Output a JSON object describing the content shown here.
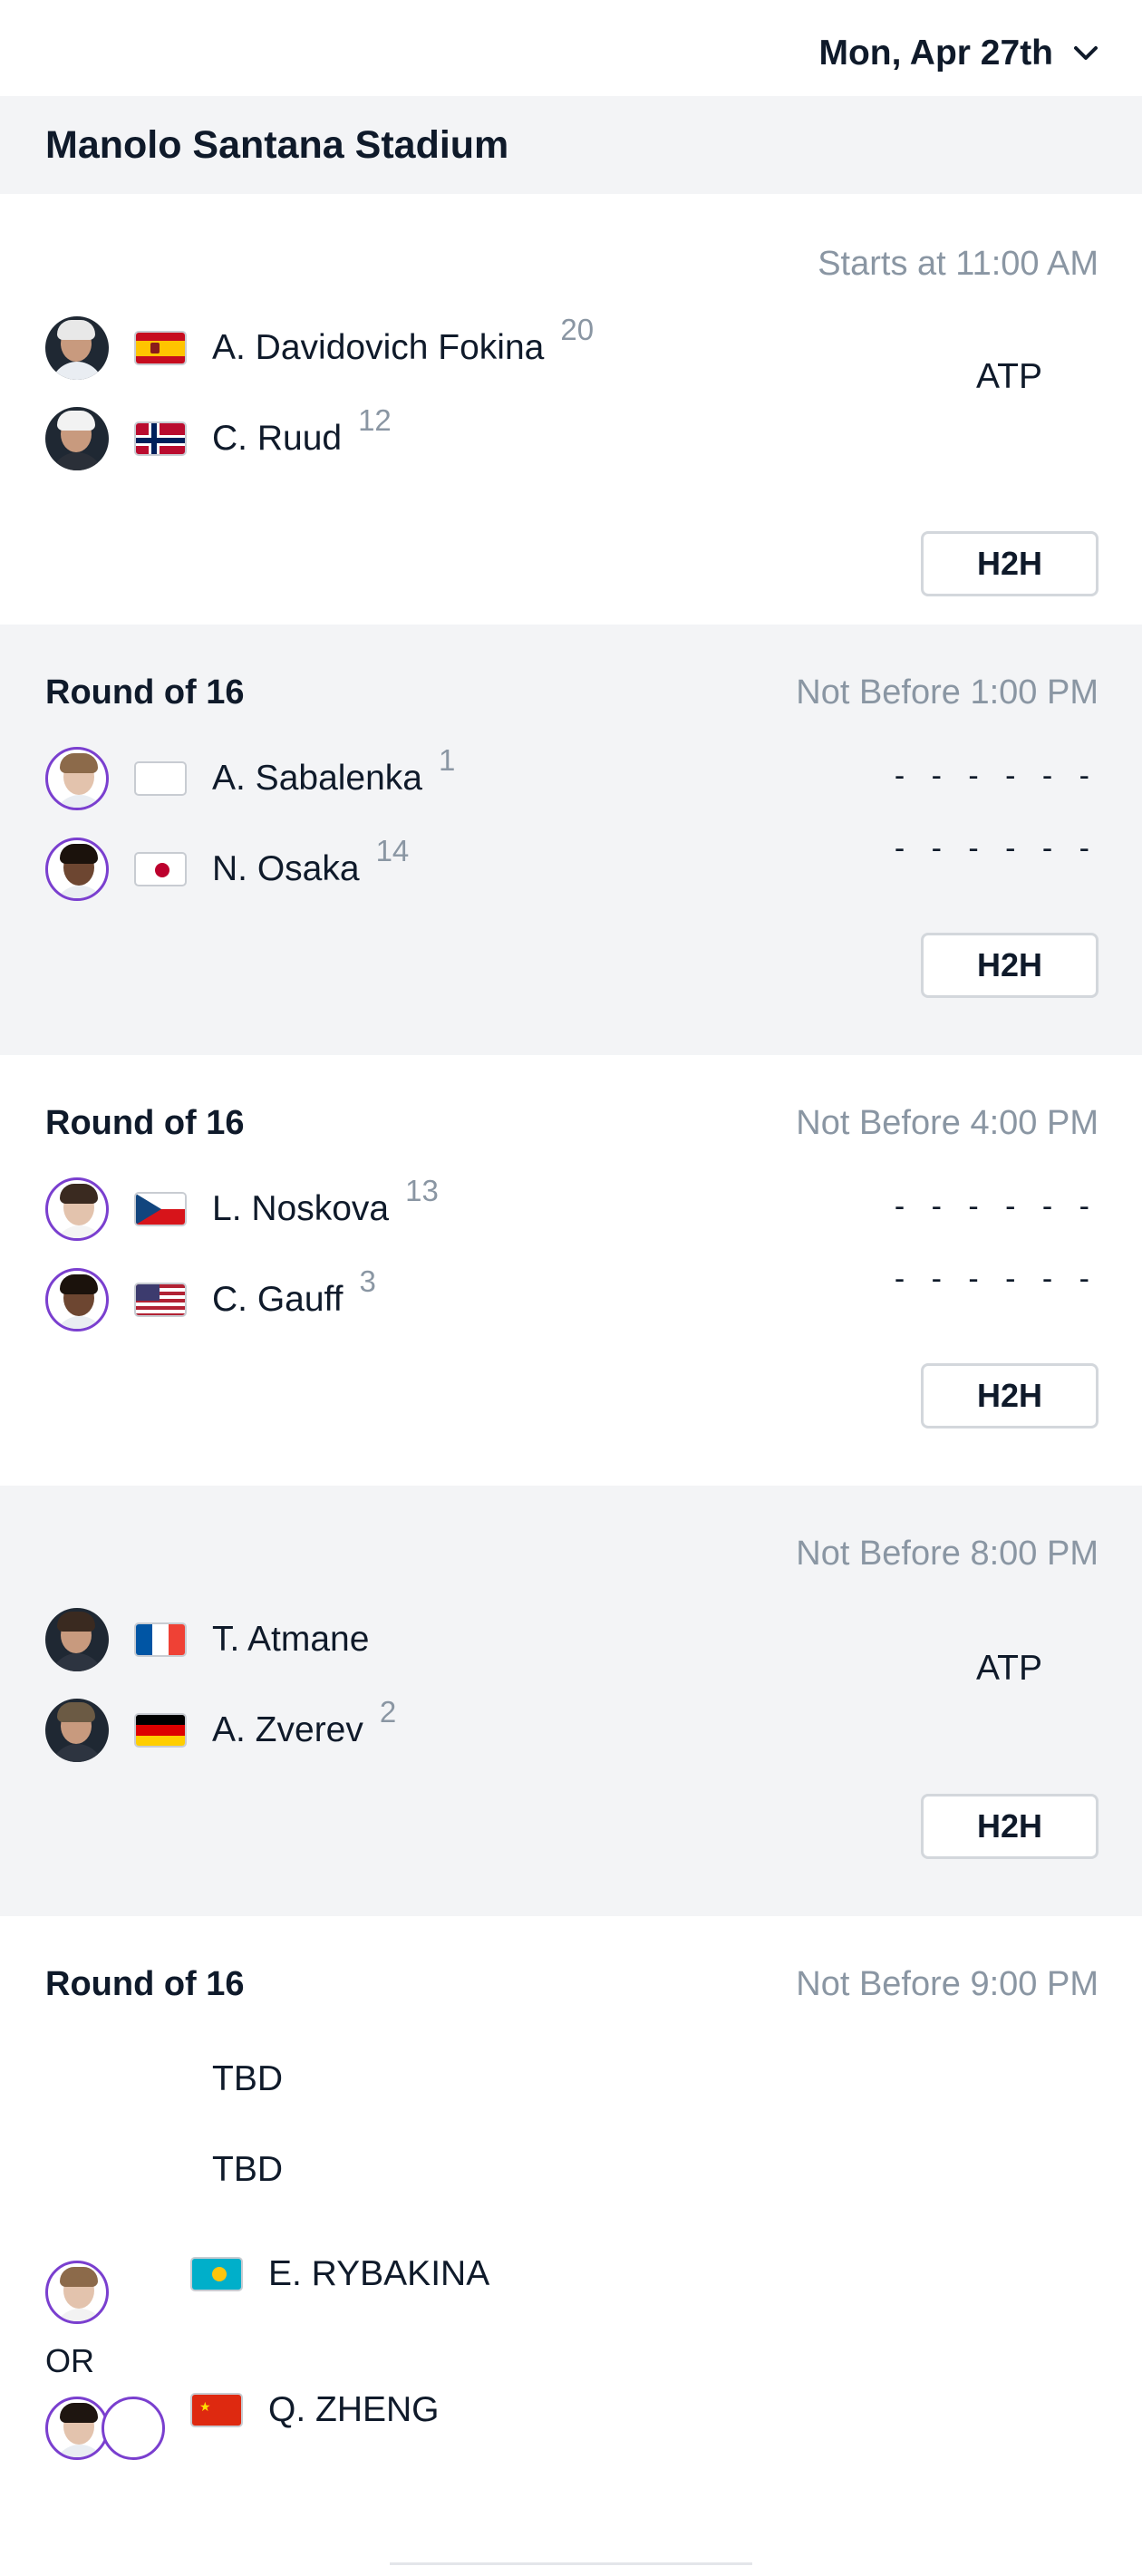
{
  "header": {
    "date_label": "Mon, Apr 27th"
  },
  "court": {
    "name": "Manolo Santana Stadium"
  },
  "matches": [
    {
      "round": "",
      "time": "Starts at 11:00 AM",
      "tour": "ATP",
      "players": [
        {
          "name": "A. Davidovich Fokina",
          "seed": "20",
          "flag": "spain-flag"
        },
        {
          "name": "C. Ruud",
          "seed": "12",
          "flag": "norway-flag"
        }
      ],
      "h2h_label": "H2H"
    },
    {
      "round": "Round of 16",
      "time": "Not Before 1:00 PM",
      "players": [
        {
          "name": "A. Sabalenka",
          "seed": "1",
          "flag": "blank-flag",
          "score": "- - - - - -"
        },
        {
          "name": "N. Osaka",
          "seed": "14",
          "flag": "japan-flag",
          "score": "- - - - - -"
        }
      ],
      "h2h_label": "H2H"
    },
    {
      "round": "Round of 16",
      "time": "Not Before 4:00 PM",
      "players": [
        {
          "name": "L. Noskova",
          "seed": "13",
          "flag": "czech-flag",
          "score": "- - - - - -"
        },
        {
          "name": "C. Gauff",
          "seed": "3",
          "flag": "usa-flag",
          "score": "- - - - - -"
        }
      ],
      "h2h_label": "H2H"
    },
    {
      "round": "",
      "time": "Not Before 8:00 PM",
      "tour": "ATP",
      "players": [
        {
          "name": "T. Atmane",
          "seed": "",
          "flag": "france-flag"
        },
        {
          "name": "A. Zverev",
          "seed": "2",
          "flag": "germany-flag"
        }
      ],
      "h2h_label": "H2H"
    },
    {
      "round": "Round of 16",
      "time": "Not Before 9:00 PM",
      "players": [
        {
          "name": "TBD"
        },
        {
          "name": "TBD"
        }
      ],
      "qualifiers": [
        {
          "name": "E. RYBAKINA",
          "flag": "kazakhstan-flag"
        },
        {
          "name": "Q. ZHENG",
          "flag": "china-flag"
        }
      ],
      "or_label": "OR"
    }
  ],
  "colors": {
    "accent_wta": "#7a3fcf",
    "muted_text": "#8a96a3",
    "grey_bg": "#f3f4f6"
  }
}
